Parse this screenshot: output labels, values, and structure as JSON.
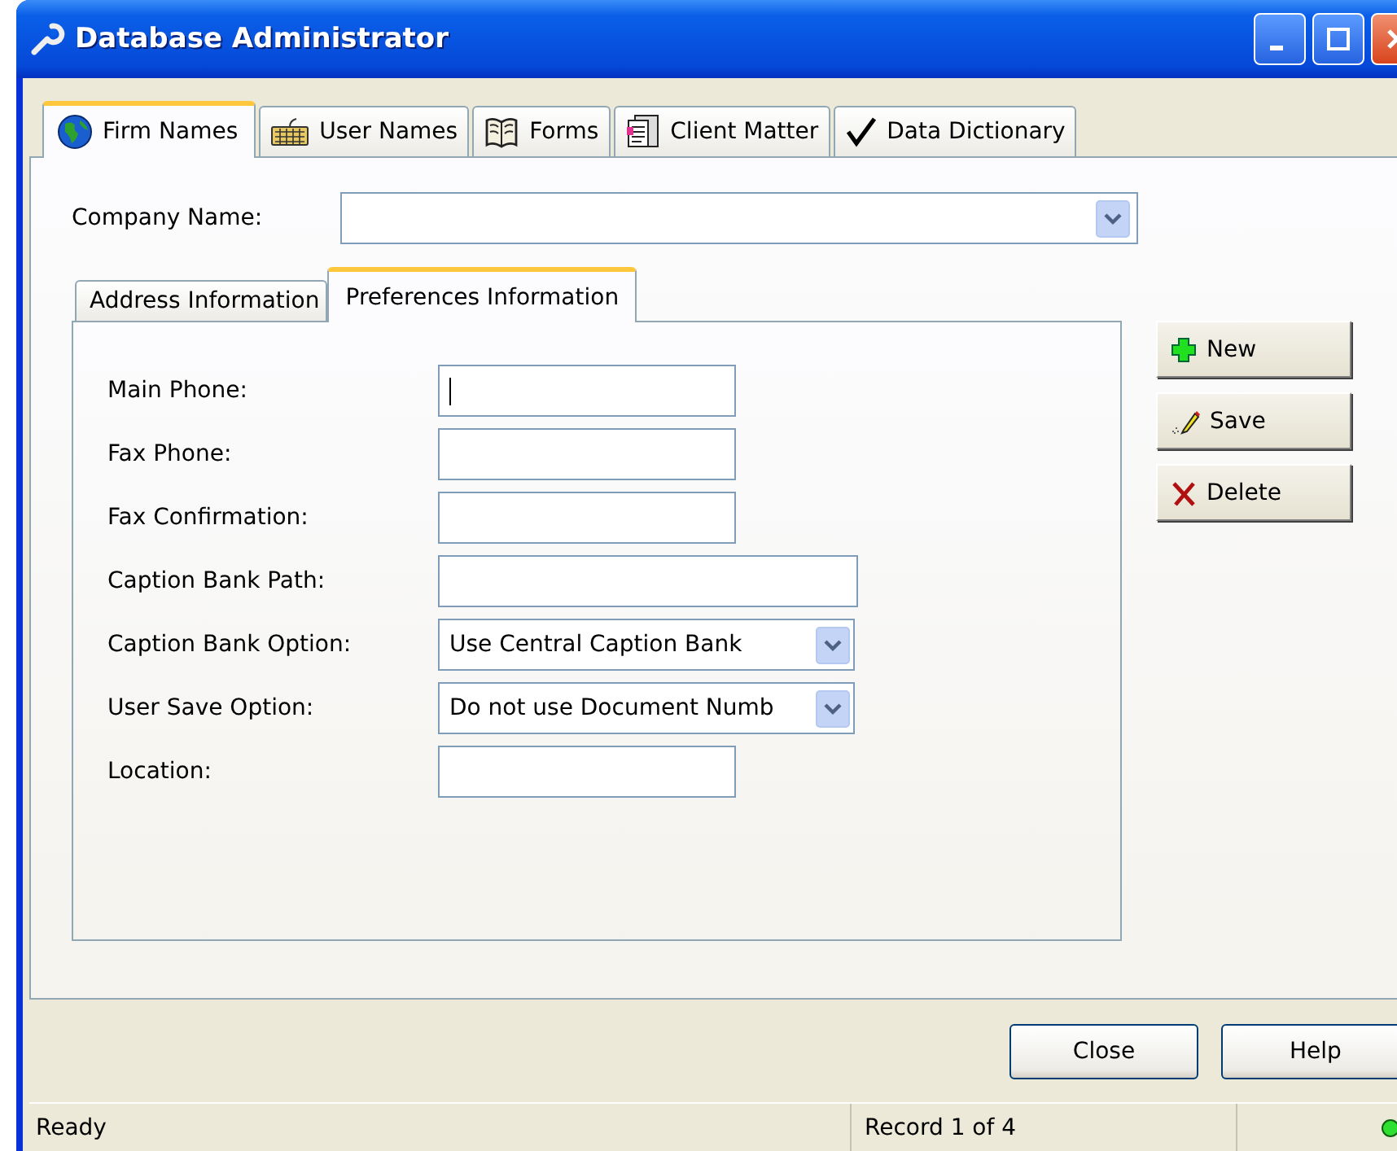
{
  "window": {
    "title": "Database Administrator"
  },
  "tabs": [
    {
      "label": "Firm Names",
      "selected": true
    },
    {
      "label": "User Names",
      "selected": false
    },
    {
      "label": "Forms",
      "selected": false
    },
    {
      "label": "Client Matter",
      "selected": false
    },
    {
      "label": "Data Dictionary",
      "selected": false
    }
  ],
  "company": {
    "label": "Company Name:"
  },
  "inner_tabs": [
    {
      "label": "Address Information",
      "selected": false
    },
    {
      "label": "Preferences Information",
      "selected": true
    }
  ],
  "fields": [
    {
      "label": "Main Phone:",
      "kind": "text",
      "focused": true
    },
    {
      "label": "Fax Phone:",
      "kind": "text",
      "focused": false
    },
    {
      "label": "Fax Confirmation:",
      "kind": "text",
      "focused": false
    },
    {
      "label": "Caption Bank Path:",
      "kind": "path",
      "focused": false
    },
    {
      "label": "Caption Bank Option:",
      "kind": "select",
      "value": "Use Central Caption Bank",
      "focused": false
    },
    {
      "label": "User Save Option:",
      "kind": "select",
      "value": "Do not use Document Numb",
      "focused": false
    },
    {
      "label": "Location:",
      "kind": "text",
      "focused": false
    }
  ],
  "side_buttons": [
    {
      "label": "New"
    },
    {
      "label": "Save"
    },
    {
      "label": "Delete"
    }
  ],
  "footer_buttons": [
    {
      "label": "Close"
    },
    {
      "label": "Help"
    }
  ],
  "status_bar": {
    "message": "Ready",
    "record": "Record 1 of 4"
  }
}
